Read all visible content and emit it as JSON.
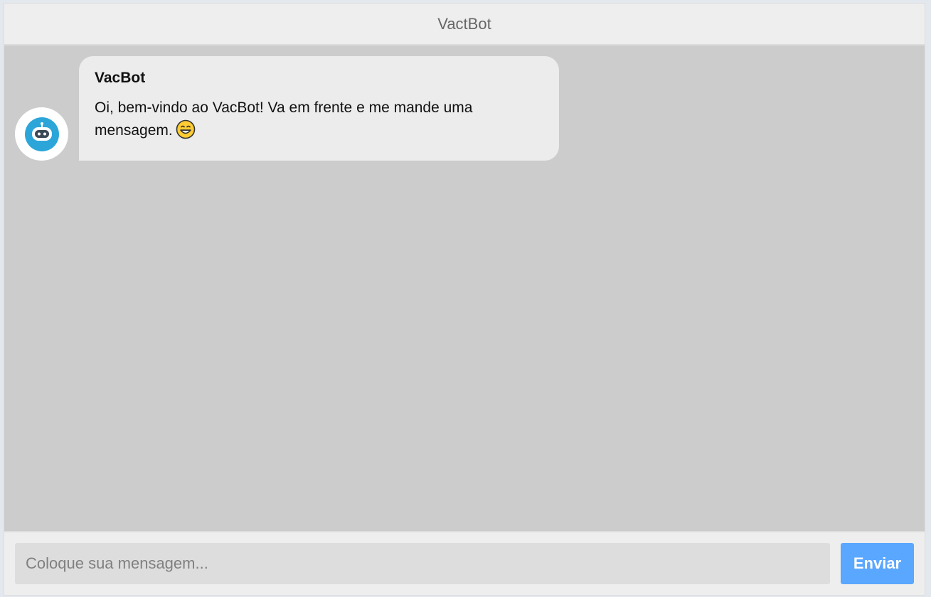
{
  "header": {
    "title": "VactBot"
  },
  "messages": [
    {
      "sender": "VacBot",
      "text": "Oi, bem-vindo ao VacBot! Va em frente e me mande uma mensagem.",
      "emoji": "grinning-face-icon",
      "avatar_icon": "robot-chat-icon"
    }
  ],
  "composer": {
    "placeholder": "Coloque sua mensagem...",
    "value": "",
    "send_label": "Enviar"
  },
  "colors": {
    "send_button": "#5aa7ff",
    "chat_background": "#cccccc",
    "bubble": "#ececec",
    "avatar_brand": "#2ca6d9"
  }
}
